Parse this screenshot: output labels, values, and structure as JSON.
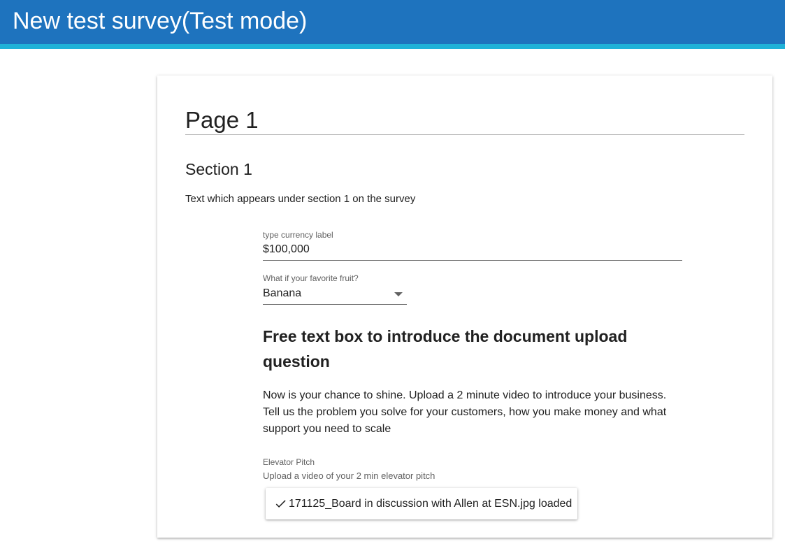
{
  "app": {
    "title": "New test survey(Test mode)",
    "colors": {
      "header": "#1e73be",
      "header_accent": "#1fb2d8"
    }
  },
  "page": {
    "title": "Page 1"
  },
  "section": {
    "title": "Section 1",
    "description": "Text which appears under section 1 on the survey"
  },
  "currency_question": {
    "label": "type currency label",
    "value": "$100,000"
  },
  "fruit_question": {
    "label": "What if your favorite fruit?",
    "selected": "Banana",
    "arrow_icon": "dropdown-arrow-icon"
  },
  "intro": {
    "heading": "Free text box to introduce the document upload question",
    "body": "Now is your chance to shine. Upload a 2 minute video to introduce your business. Tell us the problem you solve for your customers, how you make money and what support you need to scale"
  },
  "upload_question": {
    "label": "Elevator Pitch",
    "hint": "Upload a video of your 2 min elevator pitch",
    "status_icon": "check-icon",
    "file_status": "171125_Board in discussion with Allen at ESN.jpg loaded"
  }
}
